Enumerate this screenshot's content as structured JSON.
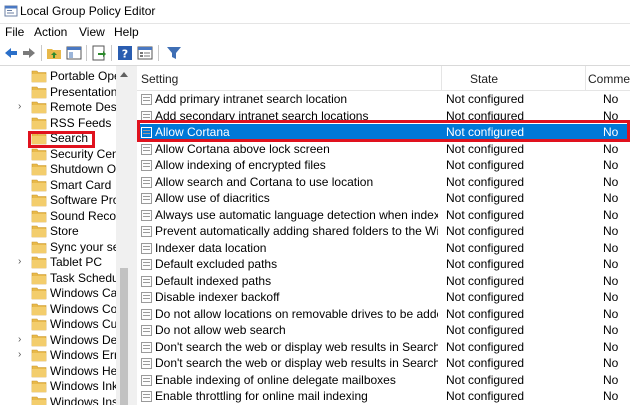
{
  "window": {
    "title": "Local Group Policy Editor"
  },
  "menu": [
    "File",
    "Action",
    "View",
    "Help"
  ],
  "toolbar_icons": [
    "back-arrow-icon",
    "forward-arrow-icon",
    "up-folder-icon",
    "show-hide-tree-icon",
    "export-list-icon",
    "help-icon",
    "properties-icon",
    "filter-icon"
  ],
  "tree": [
    {
      "label": "Portable Operati",
      "expandable": false
    },
    {
      "label": "Presentation S",
      "expandable": false
    },
    {
      "label": "Remote Deskto",
      "expandable": true
    },
    {
      "label": "RSS Feeds",
      "expandable": false
    },
    {
      "label": "Search",
      "expandable": false,
      "selected": true
    },
    {
      "label": "Security Cente",
      "expandable": false
    },
    {
      "label": "Shutdown Opt",
      "expandable": false
    },
    {
      "label": "Smart Card",
      "expandable": false
    },
    {
      "label": "Software Prote",
      "expandable": false
    },
    {
      "label": "Sound Record",
      "expandable": false
    },
    {
      "label": "Store",
      "expandable": false
    },
    {
      "label": "Sync your sett",
      "expandable": false
    },
    {
      "label": "Tablet PC",
      "expandable": true
    },
    {
      "label": "Task Schedule",
      "expandable": false
    },
    {
      "label": "Windows Cale",
      "expandable": false
    },
    {
      "label": "Windows Colo",
      "expandable": false
    },
    {
      "label": "Windows Cust",
      "expandable": false
    },
    {
      "label": "Windows Defe",
      "expandable": true
    },
    {
      "label": "Windows Erro",
      "expandable": true
    },
    {
      "label": "Windows Hello",
      "expandable": false
    },
    {
      "label": "Windows Ink V",
      "expandable": false
    },
    {
      "label": "Windows Insta",
      "expandable": false
    }
  ],
  "columns": {
    "setting": "Setting",
    "state": "State",
    "comment": "Commen"
  },
  "rows": [
    {
      "setting": "Add primary intranet search location",
      "state": "Not configured",
      "comment": "No"
    },
    {
      "setting": "Add secondary intranet search locations",
      "state": "Not configured",
      "comment": "No"
    },
    {
      "setting": "Allow Cortana",
      "state": "Not configured",
      "comment": "No",
      "selected": true
    },
    {
      "setting": "Allow Cortana above lock screen",
      "state": "Not configured",
      "comment": "No"
    },
    {
      "setting": "Allow indexing of encrypted files",
      "state": "Not configured",
      "comment": "No"
    },
    {
      "setting": "Allow search and Cortana to use location",
      "state": "Not configured",
      "comment": "No"
    },
    {
      "setting": "Allow use of diacritics",
      "state": "Not configured",
      "comment": "No"
    },
    {
      "setting": "Always use automatic language detection when indexing co...",
      "state": "Not configured",
      "comment": "No"
    },
    {
      "setting": "Prevent automatically adding shared folders to the Window...",
      "state": "Not configured",
      "comment": "No"
    },
    {
      "setting": "Indexer data location",
      "state": "Not configured",
      "comment": "No"
    },
    {
      "setting": "Default excluded paths",
      "state": "Not configured",
      "comment": "No"
    },
    {
      "setting": "Default indexed paths",
      "state": "Not configured",
      "comment": "No"
    },
    {
      "setting": "Disable indexer backoff",
      "state": "Not configured",
      "comment": "No"
    },
    {
      "setting": "Do not allow locations on removable drives to be added to li...",
      "state": "Not configured",
      "comment": "No"
    },
    {
      "setting": "Do not allow web search",
      "state": "Not configured",
      "comment": "No"
    },
    {
      "setting": "Don't search the web or display web results in Search",
      "state": "Not configured",
      "comment": "No"
    },
    {
      "setting": "Don't search the web or display web results in Search over ...",
      "state": "Not configured",
      "comment": "No"
    },
    {
      "setting": "Enable indexing of online delegate mailboxes",
      "state": "Not configured",
      "comment": "No"
    },
    {
      "setting": "Enable throttling for online mail indexing",
      "state": "Not configured",
      "comment": "No"
    }
  ],
  "colors": {
    "selection": "#0078d7",
    "highlight_box": "#e0121e",
    "folder": "#e8b94a"
  }
}
